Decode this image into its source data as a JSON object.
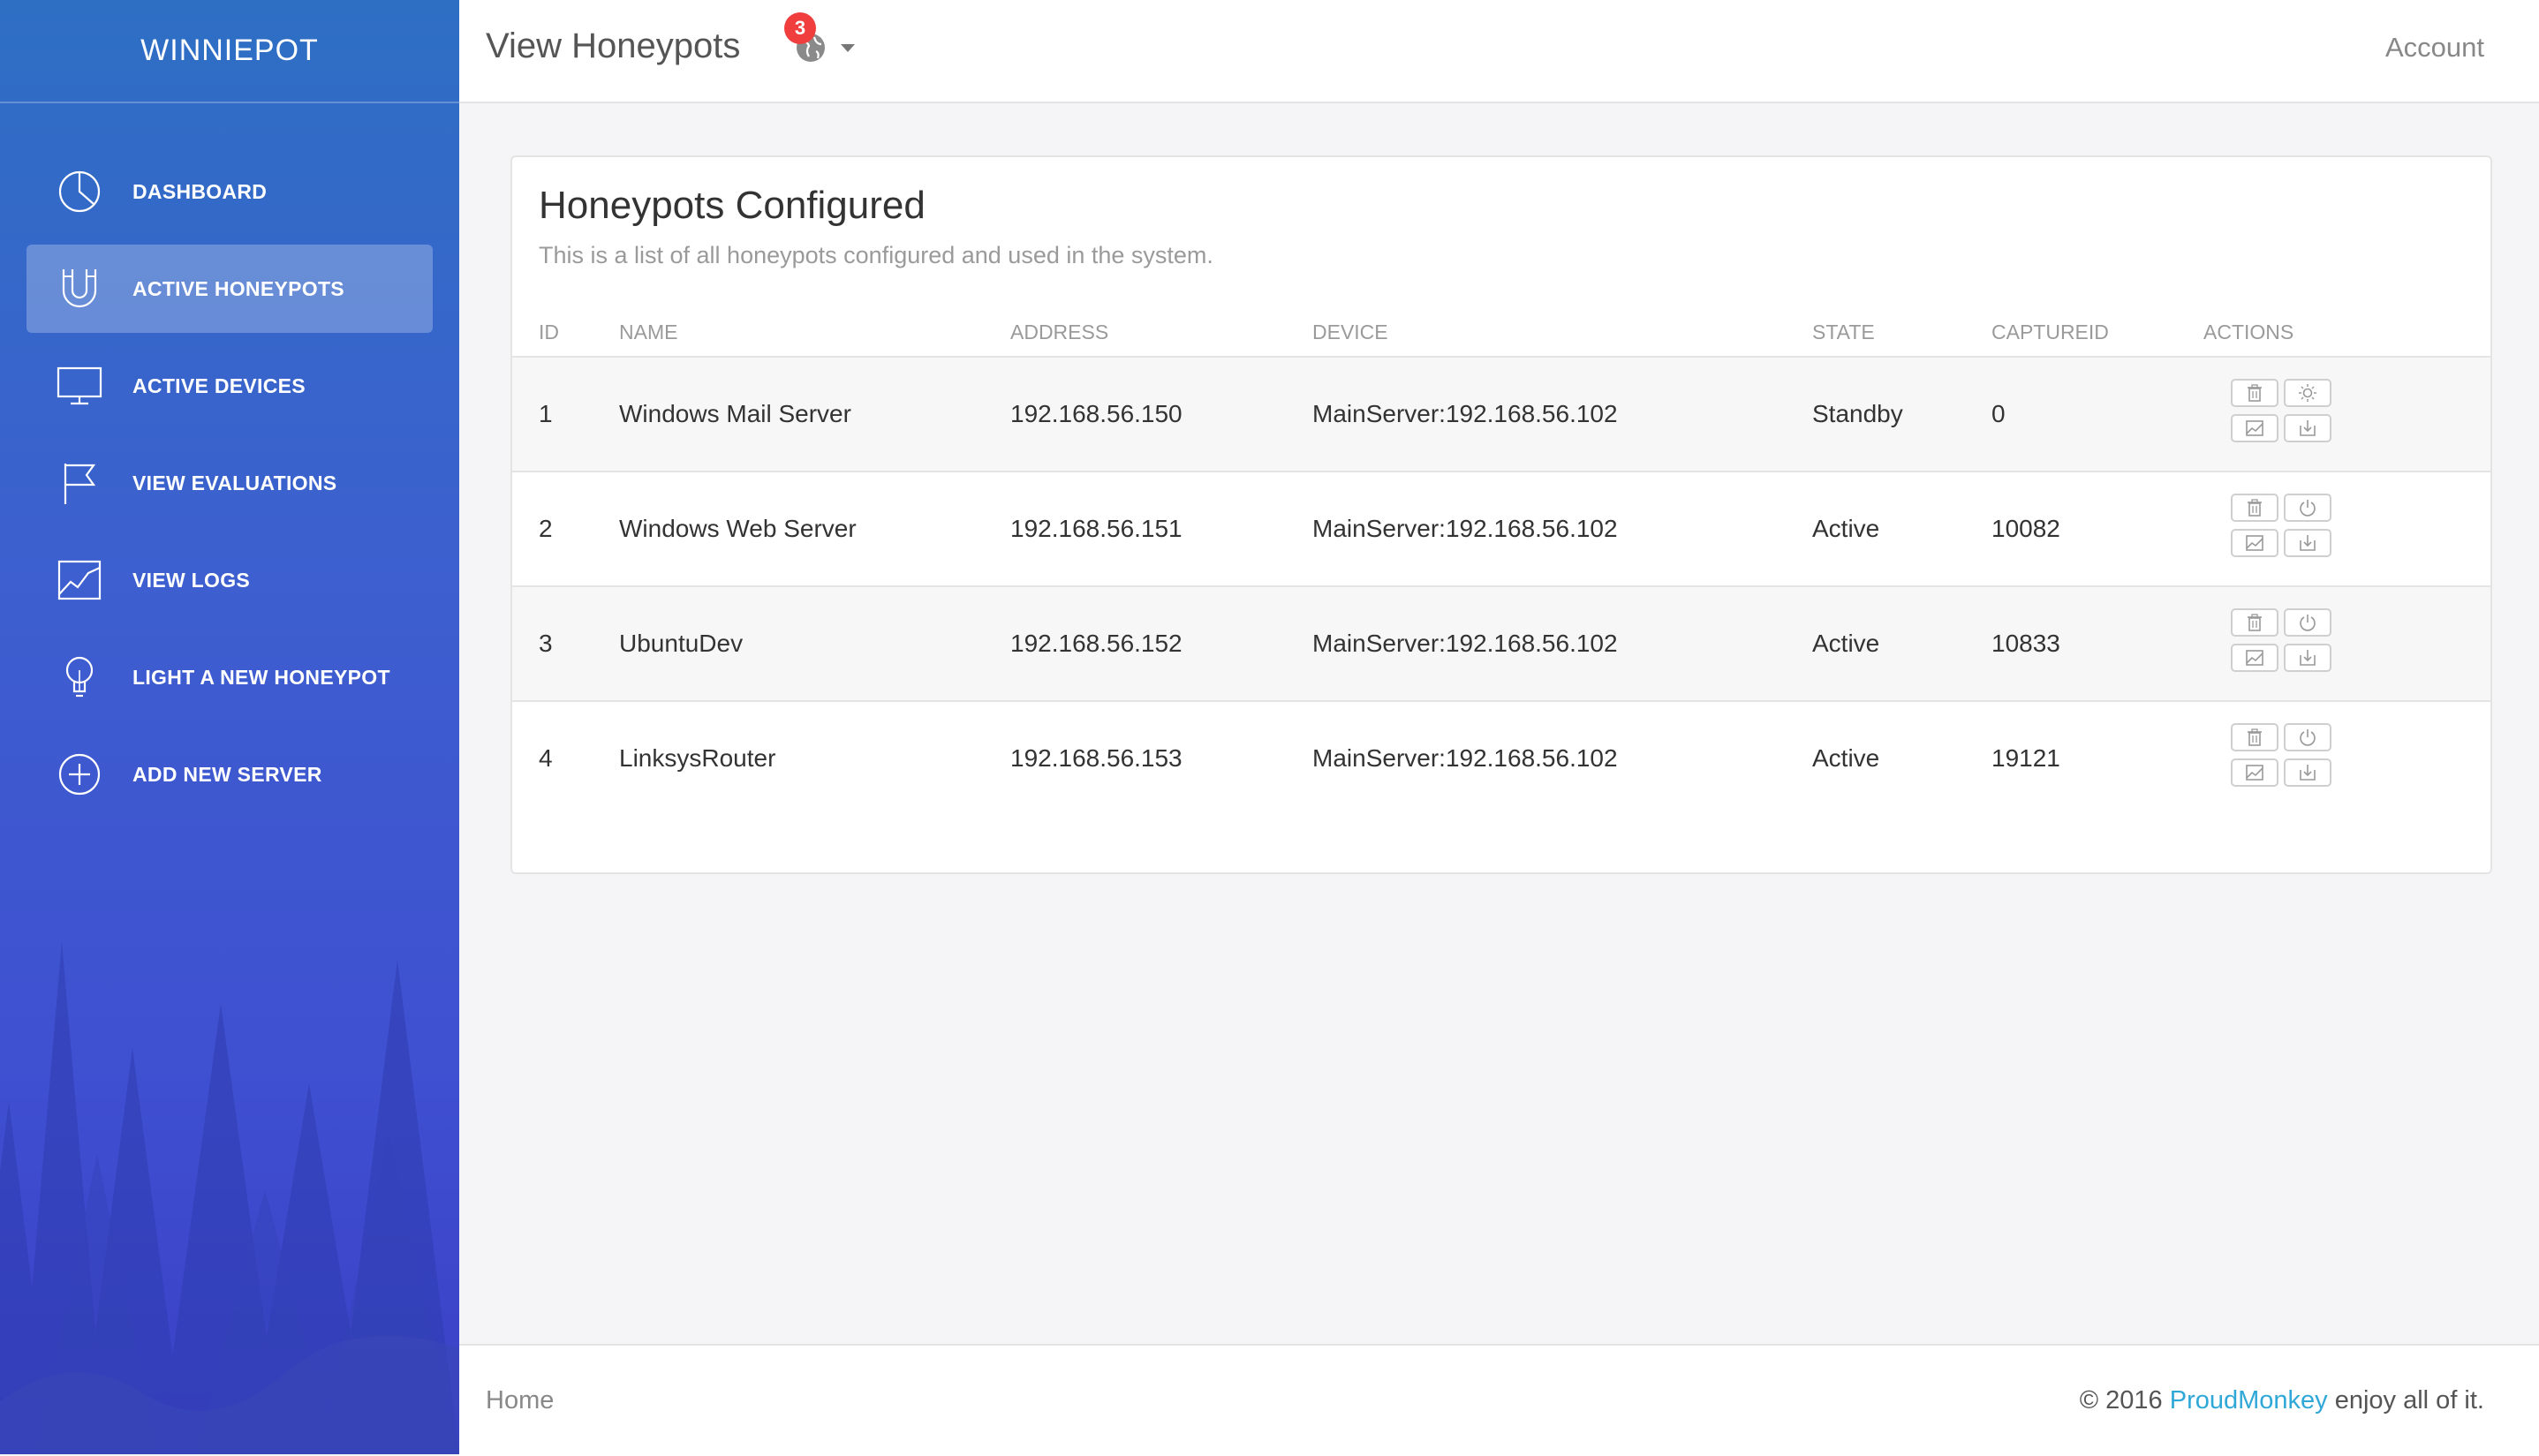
{
  "sidebar": {
    "brand": "WINNIEPOT",
    "items": [
      {
        "label": "DASHBOARD",
        "icon": "pie-chart-icon",
        "active": false
      },
      {
        "label": "ACTIVE HONEYPOTS",
        "icon": "magnet-icon",
        "active": true
      },
      {
        "label": "ACTIVE DEVICES",
        "icon": "monitor-icon",
        "active": false
      },
      {
        "label": "VIEW EVALUATIONS",
        "icon": "flag-icon",
        "active": false
      },
      {
        "label": "VIEW LOGS",
        "icon": "line-chart-icon",
        "active": false
      },
      {
        "label": "LIGHT A NEW HONEYPOT",
        "icon": "lightbulb-icon",
        "active": false
      },
      {
        "label": "ADD NEW SERVER",
        "icon": "plus-circle-icon",
        "active": false
      }
    ]
  },
  "header": {
    "title": "View Honeypots",
    "notification_count": "3",
    "account": "Account"
  },
  "card": {
    "title": "Honeypots Configured",
    "subtitle": "This is a list of all honeypots configured and used in the system.",
    "columns": [
      "ID",
      "NAME",
      "ADDRESS",
      "DEVICE",
      "STATE",
      "CAPTUREID",
      "ACTIONS"
    ],
    "rows": [
      {
        "id": "1",
        "name": "Windows Mail Server",
        "address": "192.168.56.150",
        "device": "MainServer:192.168.56.102",
        "state": "Standby",
        "captureid": "0",
        "toggle_icon": "sun-icon"
      },
      {
        "id": "2",
        "name": "Windows Web Server",
        "address": "192.168.56.151",
        "device": "MainServer:192.168.56.102",
        "state": "Active",
        "captureid": "10082",
        "toggle_icon": "power-icon"
      },
      {
        "id": "3",
        "name": "UbuntuDev",
        "address": "192.168.56.152",
        "device": "MainServer:192.168.56.102",
        "state": "Active",
        "captureid": "10833",
        "toggle_icon": "power-icon"
      },
      {
        "id": "4",
        "name": "LinksysRouter",
        "address": "192.168.56.153",
        "device": "MainServer:192.168.56.102",
        "state": "Active",
        "captureid": "19121",
        "toggle_icon": "power-icon"
      }
    ]
  },
  "footer": {
    "home": "Home",
    "copyright_prefix": "© 2016 ",
    "brand": "ProudMonkey",
    "copyright_suffix": " enjoy all of it."
  },
  "colors": {
    "sidebar_top": "#2e6fc4",
    "sidebar_bottom": "#3a3fc6",
    "badge": "#f03e3e",
    "link": "#2fa8d8"
  }
}
